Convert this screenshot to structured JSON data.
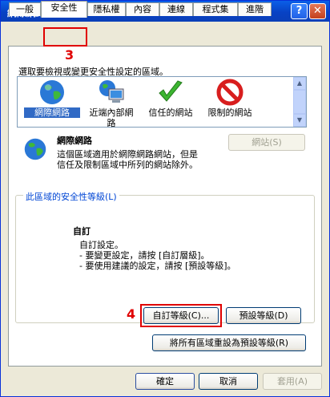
{
  "window": {
    "title": "網際網路選項"
  },
  "tabs": [
    "一般",
    "安全性",
    "隱私權",
    "內容",
    "連線",
    "程式集",
    "進階"
  ],
  "annotations": {
    "step3": "3",
    "step4": "4"
  },
  "security": {
    "zone_prompt": "選取要檢視或變更安全性設定的區域。",
    "zones": [
      {
        "label": "網際網路",
        "icon": "globe-icon",
        "selected": true
      },
      {
        "label": "近端內部網\n路",
        "icon": "local-intranet-icon",
        "selected": false
      },
      {
        "label": "信任的網站",
        "icon": "checkmark-icon",
        "selected": false
      },
      {
        "label": "限制的網站",
        "icon": "prohibited-icon",
        "selected": false
      }
    ],
    "zone_name": "網際網路",
    "zone_desc_line1": "這個區域適用於網際網路網站，但是",
    "zone_desc_line2": "信任及限制區域中所列的網站除外。",
    "sites_button": "網站(S)",
    "level_group_title": "此區域的安全性等級(L)",
    "level_name": "自訂",
    "level_desc_line1": "自訂設定。",
    "level_desc_line2": "- 要變更設定，請按 [自訂層級]。",
    "level_desc_line3": "- 要使用建議的設定，請按 [預設等級]。",
    "custom_level_button": "自訂等級(C)...",
    "default_level_button": "預設等級(D)",
    "reset_all_button": "將所有區域重設為預設等級(R)"
  },
  "footer": {
    "ok": "確定",
    "cancel": "取消",
    "apply": "套用(A)"
  }
}
